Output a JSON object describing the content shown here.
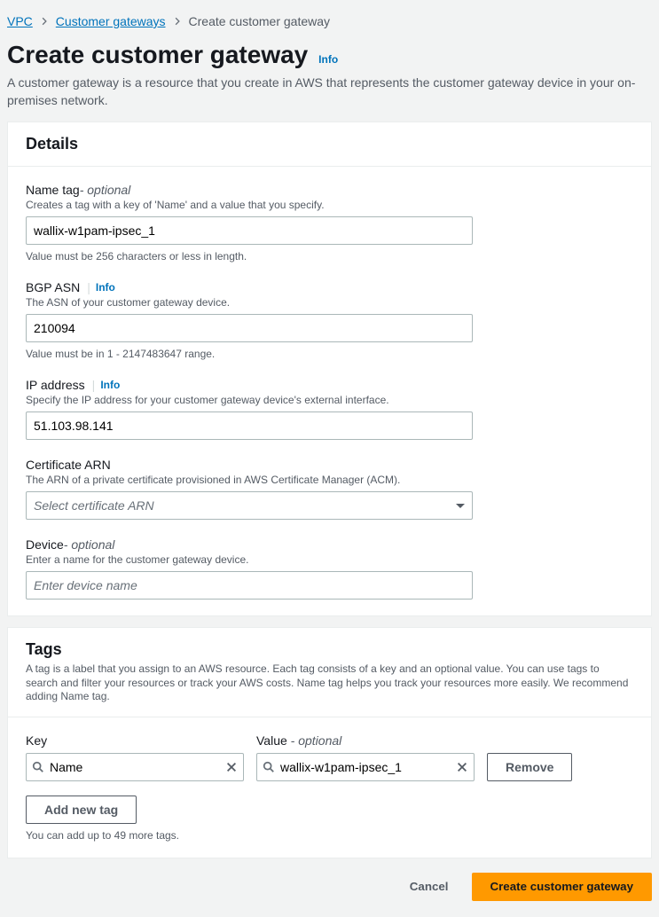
{
  "breadcrumbs": {
    "vpc": "VPC",
    "cgw": "Customer gateways",
    "current": "Create customer gateway"
  },
  "page": {
    "title": "Create customer gateway",
    "info": "Info",
    "desc": "A customer gateway is a resource that you create in AWS that represents the customer gateway device in your on-premises network."
  },
  "details": {
    "heading": "Details",
    "name_tag": {
      "label": "Name tag",
      "optional": " - optional",
      "desc": "Creates a tag with a key of 'Name' and a value that you specify.",
      "value": "wallix-w1pam-ipsec_1",
      "constraint": "Value must be 256 characters or less in length."
    },
    "bgp": {
      "label": "BGP ASN",
      "info": "Info",
      "desc": "The ASN of your customer gateway device.",
      "value": "210094",
      "constraint": "Value must be in 1 - 2147483647 range."
    },
    "ip": {
      "label": "IP address",
      "info": "Info",
      "desc": "Specify the IP address for your customer gateway device's external interface.",
      "value": "51.103.98.141"
    },
    "cert": {
      "label": "Certificate ARN",
      "desc": "The ARN of a private certificate provisioned in AWS Certificate Manager (ACM).",
      "placeholder": "Select certificate ARN"
    },
    "device": {
      "label": "Device",
      "optional": " - optional",
      "desc": "Enter a name for the customer gateway device.",
      "placeholder": "Enter device name",
      "value": ""
    }
  },
  "tags": {
    "heading": "Tags",
    "desc": "A tag is a label that you assign to an AWS resource. Each tag consists of a key and an optional value. You can use tags to search and filter your resources or track your AWS costs. Name tag helps you track your resources more easily. We recommend adding Name tag.",
    "key_label": "Key",
    "value_label": "Value",
    "value_optional": " - optional",
    "row": {
      "key": "Name",
      "value": "wallix-w1pam-ipsec_1"
    },
    "remove": "Remove",
    "add": "Add new tag",
    "limit": "You can add up to 49 more tags."
  },
  "actions": {
    "cancel": "Cancel",
    "create": "Create customer gateway"
  }
}
